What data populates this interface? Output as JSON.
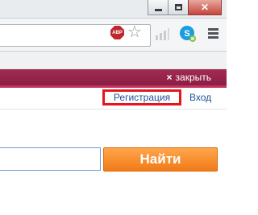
{
  "browser": {
    "window_controls": {
      "minimize": "–",
      "maximize": "□",
      "close": "✕"
    },
    "toolbar": {
      "adblock_label": "ABP",
      "icons": [
        "adblock-icon",
        "star-icon",
        "signal-icon",
        "skype-icon",
        "menu-icon"
      ]
    }
  },
  "page": {
    "notification_bar": {
      "close_label": "закрыть",
      "close_symbol": "×",
      "background_color": "#9a2550"
    },
    "auth": {
      "register_label": "Регистрация",
      "login_label": "Вход",
      "link_color": "#1f4f9a",
      "highlight_color": "#e8141b"
    },
    "search": {
      "input_value": "",
      "button_label": "Найти",
      "button_color": "#f58a2a"
    }
  }
}
